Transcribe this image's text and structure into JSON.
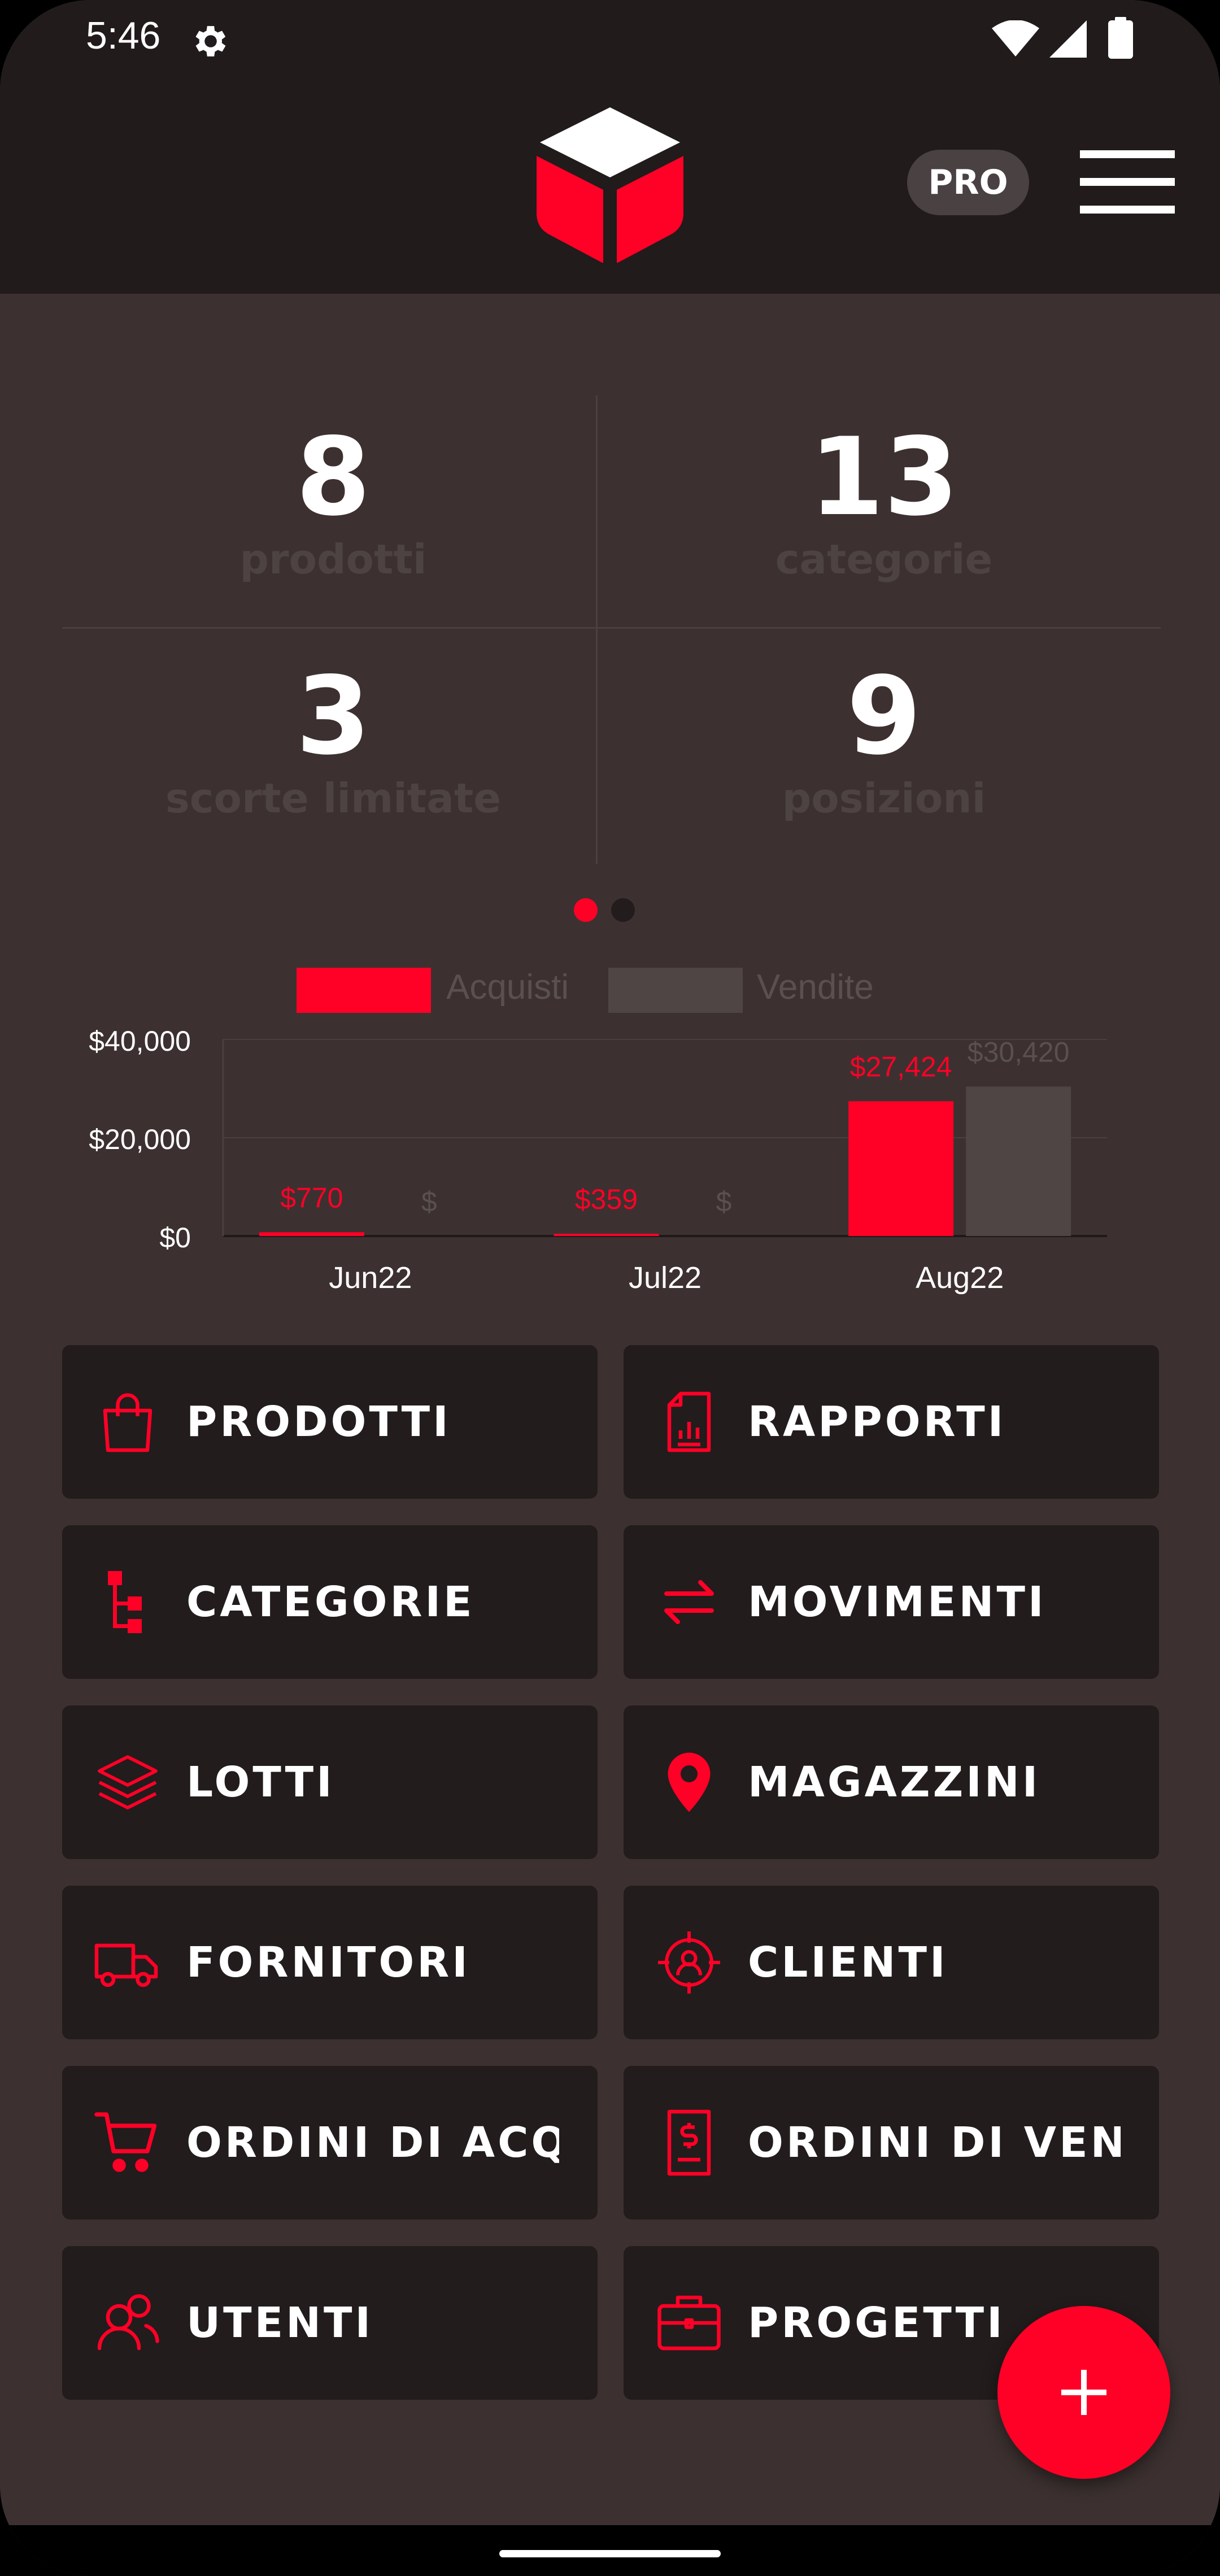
{
  "status_bar": {
    "time": "5:46"
  },
  "header": {
    "pro_label": "PRO"
  },
  "stats": [
    {
      "value": "8",
      "label": "prodotti"
    },
    {
      "value": "13",
      "label": "categorie"
    },
    {
      "value": "3",
      "label": "scorte limitate"
    },
    {
      "value": "9",
      "label": "posizioni"
    }
  ],
  "pager": {
    "pages": 2,
    "active": 0
  },
  "colors": {
    "accent": "#ff0027",
    "background": "#3c3130",
    "tile": "#221c1c",
    "sales_bar": "#4f4545"
  },
  "chart_data": {
    "type": "bar",
    "categories": [
      "Jun22",
      "Jul22",
      "Aug22"
    ],
    "series": [
      {
        "name": "Acquisti",
        "values": [
          770,
          359,
          27424
        ],
        "labels": [
          "$770",
          "$359",
          "$27,424"
        ],
        "color": "#ff0027"
      },
      {
        "name": "Vendite",
        "values": [
          0,
          0,
          30420
        ],
        "labels": [
          "$",
          "$",
          "$30,420"
        ],
        "color": "#4f4545"
      }
    ],
    "y_ticks": [
      "$40,000",
      "$20,000",
      "$0"
    ],
    "y_tick_values": [
      40000,
      20000,
      0
    ],
    "ylim": [
      0,
      40000
    ],
    "legend": "top-center",
    "grid": true
  },
  "menu": [
    {
      "label": "PRODOTTI",
      "icon": "shopping-bag-icon"
    },
    {
      "label": "RAPPORTI",
      "icon": "report-icon"
    },
    {
      "label": "CATEGORIE",
      "icon": "category-tree-icon"
    },
    {
      "label": "MOVIMENTI",
      "icon": "transfer-arrows-icon"
    },
    {
      "label": "LOTTI",
      "icon": "layers-icon"
    },
    {
      "label": "MAGAZZINI",
      "icon": "location-pin-icon"
    },
    {
      "label": "FORNITORI",
      "icon": "truck-icon"
    },
    {
      "label": "CLIENTI",
      "icon": "customer-target-icon"
    },
    {
      "label": "ORDINI DI ACQUISTO",
      "icon": "cart-icon"
    },
    {
      "label": "ORDINI DI VENDITA",
      "icon": "invoice-icon"
    },
    {
      "label": "UTENTI",
      "icon": "users-icon"
    },
    {
      "label": "PROGETTI",
      "icon": "briefcase-icon"
    }
  ]
}
